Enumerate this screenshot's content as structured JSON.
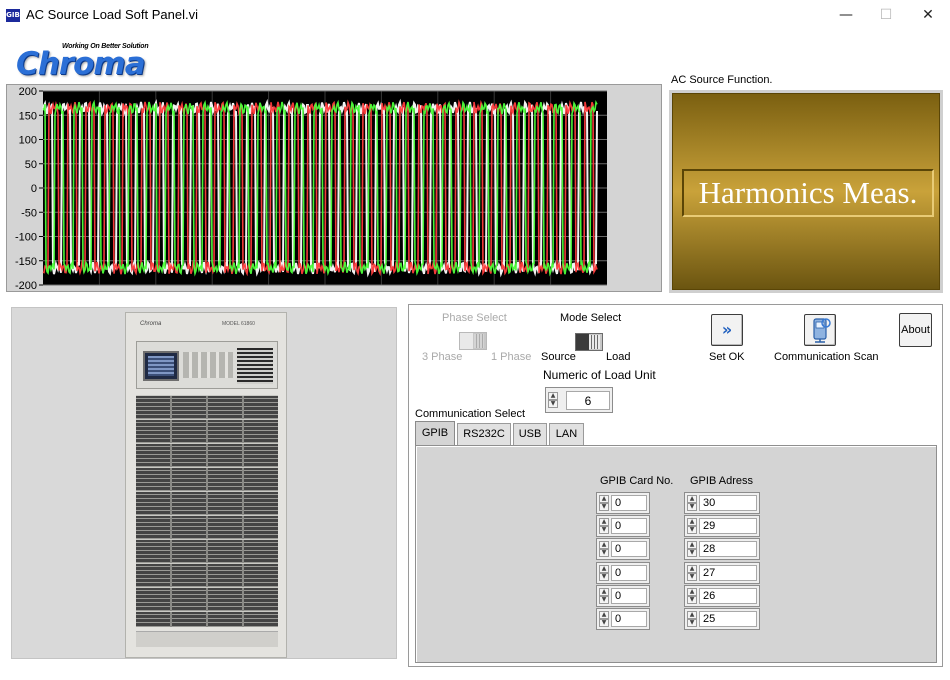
{
  "window": {
    "icon_text": "GIB",
    "title": "AC Source Load Soft Panel.vi",
    "minimize": "—",
    "maximize": "☐",
    "close": "✕"
  },
  "logo": {
    "tagline": "Working On Better Solution",
    "wordmark": "Chroma"
  },
  "chart_data": {
    "type": "line",
    "title": "",
    "xlabel": "",
    "ylabel": "",
    "ylim": [
      -200,
      200
    ],
    "ytick_labels": [
      "200",
      "150",
      "100",
      "50",
      "0",
      "-50",
      "-100",
      "-150",
      "-200"
    ],
    "grid": true,
    "background": "#000000",
    "waveform": "square wave, 30 cycles, amplitude ±165 with harmonic ripple",
    "series": [
      {
        "color": "#ffffff",
        "amplitude": 165,
        "cycles": 30
      },
      {
        "color": "#ff3b3b",
        "amplitude": 165,
        "cycles": 30
      },
      {
        "color": "#4cff3a",
        "amplitude": 165,
        "cycles": 30
      }
    ]
  },
  "function_display": {
    "caption": "AC Source Function.",
    "value": "Harmonics Meas."
  },
  "device_image": {
    "brand": "Chroma",
    "model": "MODEL 61860"
  },
  "controls": {
    "phase_select": {
      "title": "Phase Select",
      "left": "3 Phase",
      "right": "1 Phase",
      "enabled": false
    },
    "mode_select": {
      "title": "Mode Select",
      "left": "Source",
      "right": "Load",
      "value": "Load"
    },
    "numeric_load_unit": {
      "label": "Numeric of Load Unit",
      "value": "6"
    },
    "set_ok": {
      "label": "Set OK",
      "glyph": "»"
    },
    "comm_scan": {
      "label": "Communication Scan"
    },
    "about": {
      "label": "About"
    }
  },
  "comm": {
    "title": "Communication Select",
    "tabs": [
      "GPIB",
      "RS232C",
      "USB",
      "LAN"
    ],
    "active_tab": "GPIB",
    "gpib": {
      "card_header": "GPIB Card No.",
      "address_header": "GPIB Adress",
      "card_numbers": [
        "0",
        "0",
        "0",
        "0",
        "0",
        "0"
      ],
      "addresses": [
        "30",
        "29",
        "28",
        "27",
        "26",
        "25"
      ]
    }
  }
}
